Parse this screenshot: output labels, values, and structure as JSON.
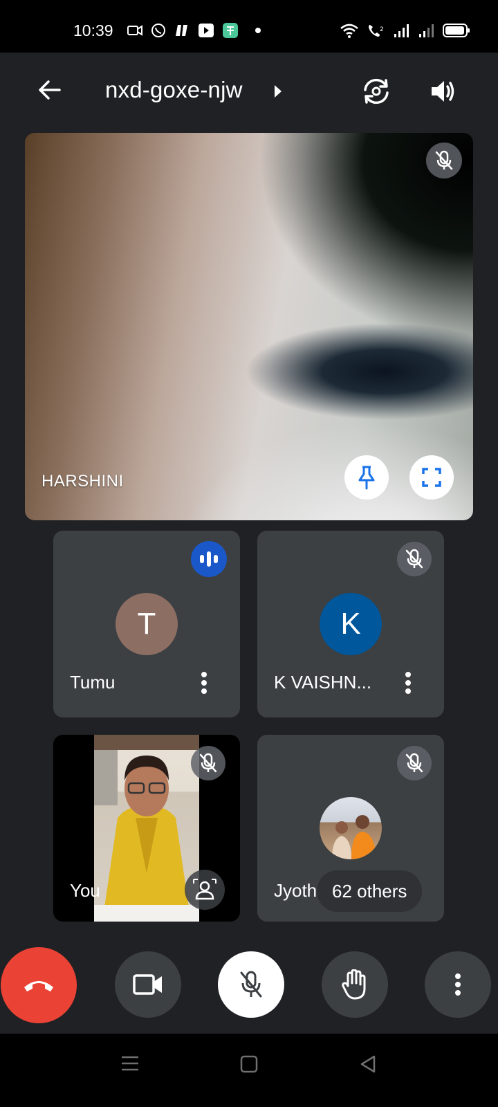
{
  "status_bar": {
    "time": "10:39"
  },
  "header": {
    "meeting_code": "nxd-goxe-njw"
  },
  "main_tile": {
    "name": "HARSHINI"
  },
  "participants": [
    {
      "name": "Tumu",
      "initial": "T",
      "avatar_color": "#8d6e63",
      "speaking": true
    },
    {
      "name": "K VAISHN...",
      "initial": "K",
      "avatar_color": "#01579b",
      "muted": true
    },
    {
      "name": "You",
      "muted": true
    },
    {
      "name": "Jyothi",
      "muted": true,
      "others_label": "62 others"
    }
  ],
  "colors": {
    "end_call": "#ea4335",
    "speaking_badge": "#1a73e8",
    "control_bg": "#3c4043"
  }
}
